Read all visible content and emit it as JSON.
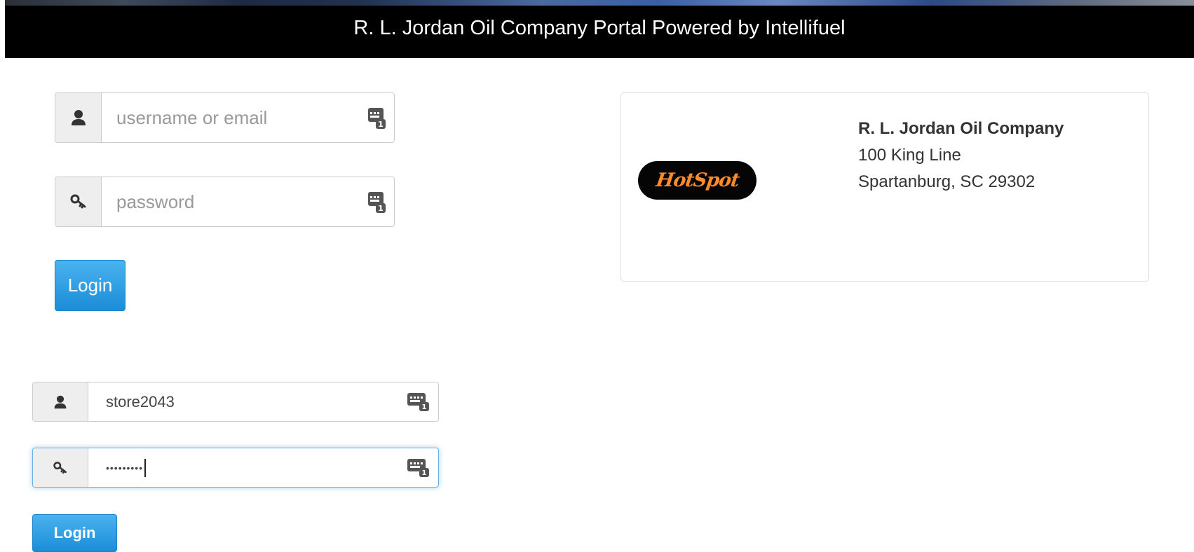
{
  "header": {
    "title": "R. L. Jordan Oil Company Portal Powered by Intellifuel"
  },
  "login_form_top": {
    "username_placeholder": "username or email",
    "password_placeholder": "password",
    "login_label": "Login"
  },
  "login_form_bottom": {
    "username_value": "store2043",
    "password_value": "•••••••••",
    "login_label": "Login"
  },
  "company_card": {
    "logo_text": "HotSpot",
    "name": "R. L. Jordan Oil Company",
    "address_line1": "100 King Line",
    "address_line2": "Spartanburg, SC 29302"
  },
  "icons": {
    "user": "user-icon",
    "key": "key-icon",
    "keyboard": "keyboard-icon"
  },
  "colors": {
    "header_bg": "#000000",
    "button_bg": "#2a9fe6",
    "focus_border": "#66afe9",
    "logo_orange": "#ff8a2a"
  }
}
